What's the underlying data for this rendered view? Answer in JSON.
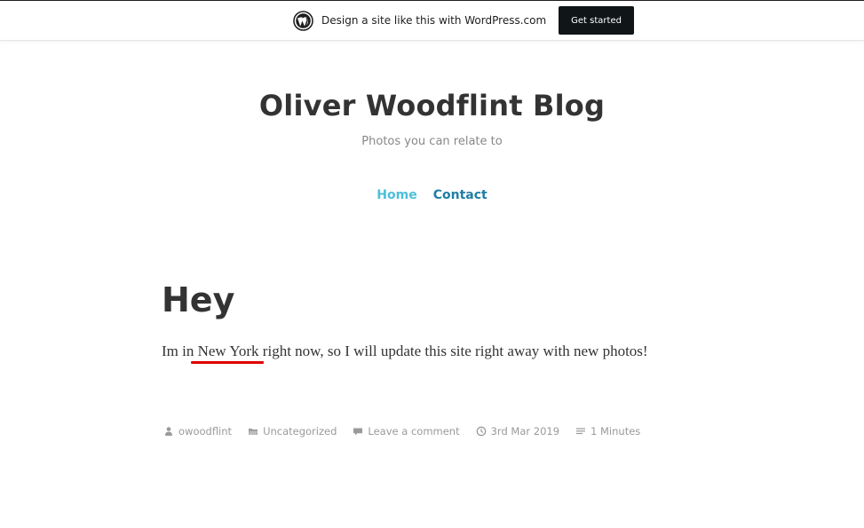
{
  "banner": {
    "text": "Design a site like this with WordPress.com",
    "button_label": "Get started"
  },
  "site": {
    "title": "Oliver Woodflint Blog",
    "description": "Photos you can relate to"
  },
  "nav": {
    "items": [
      {
        "label": "Home"
      },
      {
        "label": "Contact"
      }
    ]
  },
  "post": {
    "title": "Hey",
    "body": "Im in New York right now, so I will update this site right away with new photos!",
    "meta": {
      "author": "owoodflint",
      "category": "Uncategorized",
      "comments": "Leave a comment",
      "date": "3rd Mar 2019",
      "reading_time": "1 Minutes"
    }
  },
  "colors": {
    "nav_home": "#4cbfda",
    "nav_contact": "#1f7ea3",
    "annotation_underline": "#e00000",
    "banner_button": "#101517"
  },
  "icons": {
    "banner": "wordpress-logo-icon",
    "author": "user-icon",
    "category": "folder-icon",
    "comments": "comment-icon",
    "date": "clock-icon",
    "reading_time": "list-icon"
  }
}
